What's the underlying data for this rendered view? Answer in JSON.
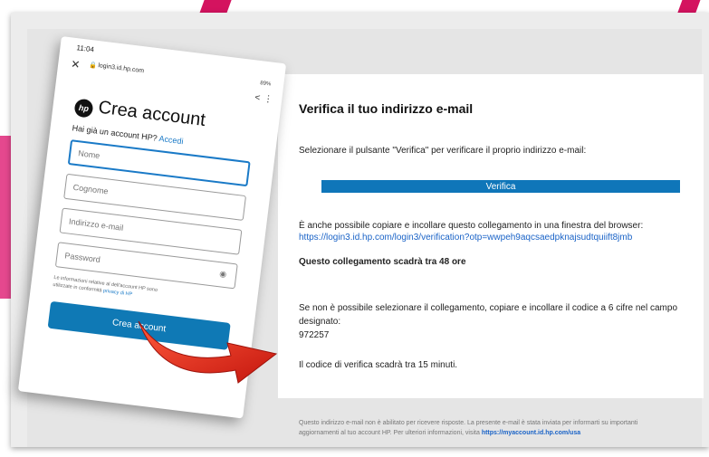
{
  "phone": {
    "status_time": "11:04",
    "close_glyph": "✕",
    "url": "login3.id.hp.com",
    "signal": "89%",
    "share_glyph": "<",
    "more_glyph": "⋮",
    "logo_text": "hp",
    "title": "Crea account",
    "have_account": "Hai già un account HP?",
    "login_link": "Accedi",
    "name_placeholder": "Nome",
    "surname_placeholder": "Cognome",
    "email_placeholder": "Indirizzo e-mail",
    "password_placeholder": "Password",
    "legal_start": "Le informazioni relative",
    "legal_mid": "al",
    "legal_rest": "dell'account HP sono",
    "legal_line2": "utilizzate in conformità",
    "legal_link": "privacy di HP",
    "create_button": "Crea account"
  },
  "email": {
    "title": "Verifica il tuo indirizzo e-mail",
    "instruction": "Selezionare il pulsante \"Verifica\" per verificare il proprio indirizzo e-mail:",
    "verify_button": "Verifica",
    "alt_text": "È anche possibile copiare e incollare questo collegamento in una finestra del browser:",
    "link": "https://login3.id.hp.com/login3/verification?otp=wwpeh9aqcsaedpknajsudtquiift8jmb",
    "link_expiry": "Questo collegamento scadrà tra 48 ore",
    "code_instruction": "Se non è possibile selezionare il collegamento, copiare e incollare il codice a 6 cifre nel campo designato:",
    "code": "972257",
    "code_expiry": "Il codice di verifica scadrà tra 15 minuti."
  },
  "footer": {
    "text1": "Questo indirizzo e-mail non è abilitato per ricevere risposte. La presente e-mail è stata inviata per informarti su importanti aggiornamenti al tuo account HP. Per ulteriori informazioni, visita",
    "link": "https://myaccount.id.hp.com/usa"
  },
  "colors": {
    "hp_blue": "#0f76b9",
    "link_blue": "#1a63c7",
    "arrow_red": "#e1261c",
    "accent_pink": "#d4135f"
  },
  "icons": [
    "close-icon",
    "lock-icon",
    "share-icon",
    "more-icon",
    "hp-logo",
    "eye-icon",
    "arrow-icon"
  ]
}
